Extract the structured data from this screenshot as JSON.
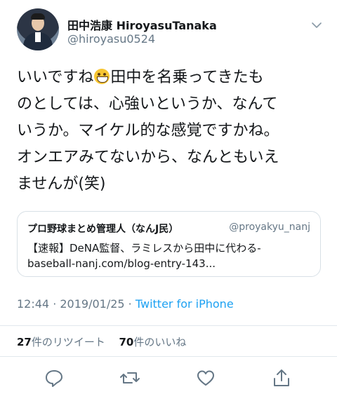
{
  "user": {
    "display_name": "田中浩康 HiroyasuTanaka",
    "handle": "@hiroyasu0524"
  },
  "tweet": {
    "line1_before": "いいですね",
    "line1_after": "田中を名乗ってきたも",
    "line2": "のとしては、心強いというか、なんて",
    "line3": "いうか。マイケル的な感覚ですかね。",
    "line4": "オンエアみてないから、なんともいえ",
    "line5": "ませんが(笑)",
    "emoji": "grinning-face-icon"
  },
  "quoted": {
    "title": "プロ野球まとめ管理人（なんJ民）",
    "handle": "@proyakyu_nanj",
    "line1": "【速報】DeNA監督、ラミレスから田中に代わる-",
    "line2": "baseball-nanj.com/blog-entry-143..."
  },
  "meta": {
    "time": "12:44",
    "separator": " · ",
    "date": "2019/01/25",
    "separator2": " · ",
    "source": "Twitter for iPhone"
  },
  "stats": {
    "retweet_count": "27",
    "retweet_label": "件のリツイート",
    "like_count": "70",
    "like_label": "件のいいね"
  },
  "actions": [
    "reply-icon",
    "retweet-icon",
    "like-icon",
    "share-icon"
  ],
  "colors": {
    "link": "#1da1f2",
    "secondary": "#657786",
    "text": "#14171a",
    "border": "#e1e8ed"
  }
}
